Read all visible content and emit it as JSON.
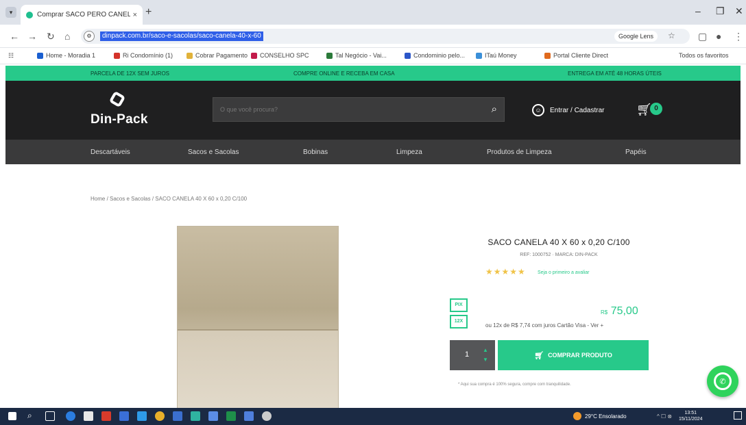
{
  "browser": {
    "tab_title": "Comprar SACO PERO CANELA...",
    "tab_close": "×",
    "new_tab": "+",
    "url": "dinpack.com.br/saco-e-sacolas/saco-canela-40-x-60",
    "google_btn": "Google Lens",
    "bookmarks": [
      "Home - Moradia 1",
      "Ri Condomínio (1)",
      "Cobrar Pagamento",
      "CONSELHO SPC",
      "Tal Negócio - Vai...",
      "Condominio pelo...",
      "ITaú Money",
      "Portal Cliente Direct"
    ],
    "bookmarks_right": "Todos os favoritos"
  },
  "topbar": {
    "left": "PARCELA DE 12X SEM JUROS",
    "center": "COMPRE ONLINE E RECEBA EM CASA",
    "right": "ENTREGA EM ATÉ 48 HORAS ÚTEIS"
  },
  "header": {
    "logo": "Din-Pack",
    "search_placeholder": "O que você procura?",
    "account": "Entrar / Cadastrar",
    "cart_count": "0"
  },
  "nav": {
    "items": [
      "Descartáveis",
      "Sacos e Sacolas",
      "Bobinas",
      "Limpeza",
      "Produtos de Limpeza",
      "Papéis"
    ]
  },
  "breadcrumb": "Home / Sacos e Sacolas / SACO CANELA 40 X 60 x 0,20 C/100",
  "product": {
    "title": "SACO CANELA 40 X 60 x 0,20 C/100",
    "sku": "REF: 1000752 · MARCA: DIN-PACK",
    "stars": "★★★★★",
    "review_link": "Seja o primeiro a avaliar",
    "badge_a": "PIX",
    "badge_b": "12X",
    "currency": "R$",
    "price": "75,00",
    "installments": "ou 12x de R$ 7,74 com juros Cartão Visa - Ver +",
    "qty": "1",
    "buy_label": "COMPRAR PRODUTO",
    "note": "* Aqui sua compra é 100% segura, compre com tranquilidade."
  },
  "taskbar": {
    "weather": "29°C Ensolarado",
    "tray": "^ ☐ ⊗",
    "time": "13:51",
    "date": "15/11/2024"
  },
  "colors": {
    "accent": "#27c98a",
    "header_bg": "#1f1f20",
    "nav_bg": "#3a3a3b"
  }
}
